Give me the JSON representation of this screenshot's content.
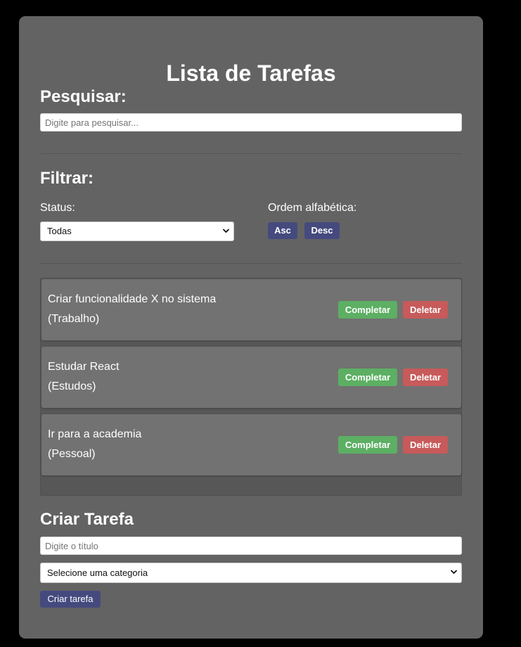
{
  "app": {
    "title": "Lista de Tarefas"
  },
  "search": {
    "heading": "Pesquisar:",
    "placeholder": "Digite para pesquisar...",
    "value": ""
  },
  "filter": {
    "heading": "Filtrar:",
    "status_label": "Status:",
    "status_selected": "Todas",
    "sort_label": "Ordem alfabética:",
    "asc_label": "Asc",
    "desc_label": "Desc"
  },
  "tasks": [
    {
      "title": "Criar funcionalidade X no sistema",
      "category": "(Trabalho)",
      "complete_label": "Completar",
      "delete_label": "Deletar"
    },
    {
      "title": "Estudar React",
      "category": "(Estudos)",
      "complete_label": "Completar",
      "delete_label": "Deletar"
    },
    {
      "title": "Ir para a academia",
      "category": "(Pessoal)",
      "complete_label": "Completar",
      "delete_label": "Deletar"
    }
  ],
  "create": {
    "heading": "Criar Tarefa",
    "title_placeholder": "Digite o título",
    "title_value": "",
    "category_selected": "Selecione uma categoria",
    "submit_label": "Criar tarefa"
  },
  "icons": {
    "select_arrow": "chevron-down-icon"
  },
  "colors": {
    "page_background": "#000000",
    "panel_background": "#636363",
    "task_background": "#727272",
    "list_background": "#575757",
    "primary_button": "#454a7e",
    "complete_button": "#5caf63",
    "delete_button": "#c75a5a"
  }
}
